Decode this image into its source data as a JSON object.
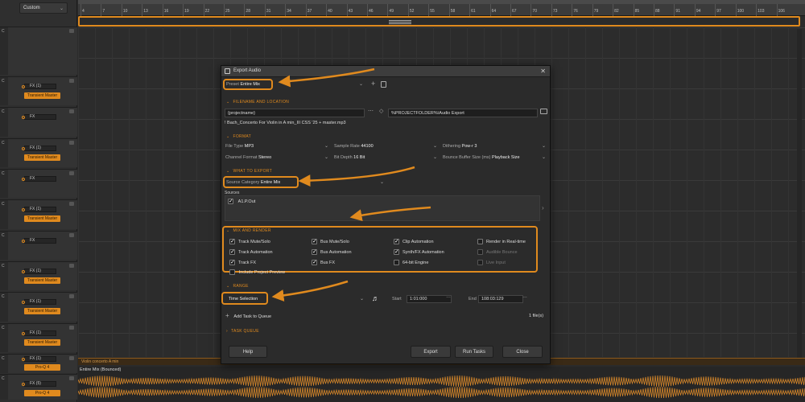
{
  "left_panel": {
    "preset": "Custom",
    "tracks": [
      {
        "fx": "",
        "plugin": ""
      },
      {
        "fx": "FX (1)",
        "plugin": "Transient Master"
      },
      {
        "fx": "FX",
        "plugin": ""
      },
      {
        "fx": "FX (1)",
        "plugin": "Transient Master"
      },
      {
        "fx": "FX",
        "plugin": ""
      },
      {
        "fx": "FX (1)",
        "plugin": "Transient Master"
      },
      {
        "fx": "FX",
        "plugin": ""
      },
      {
        "fx": "FX (1)",
        "plugin": "Transient Master"
      },
      {
        "fx": "FX (1)",
        "plugin": "Transient Master"
      },
      {
        "fx": "FX (1)",
        "plugin": "Transient Master"
      },
      {
        "fx": "FX (1)",
        "plugin": "Pro-Q 4"
      },
      {
        "fx": "FX (5)",
        "plugin": "Pro-Q 4"
      }
    ]
  },
  "ruler": {
    "bars": [
      "4",
      "7",
      "10",
      "13",
      "16",
      "19",
      "22",
      "25",
      "28",
      "31",
      "34",
      "37",
      "40",
      "43",
      "46",
      "49",
      "52",
      "55",
      "58",
      "61",
      "64",
      "67",
      "70",
      "73",
      "76",
      "79",
      "82",
      "85",
      "88",
      "91",
      "94",
      "97",
      "100",
      "103",
      "106"
    ]
  },
  "arrange": {
    "clip_label": "Violin concerto A min",
    "bounce_label": "Entire Mix (Bounced)"
  },
  "dialog": {
    "title": "Export Audio",
    "preset_label": "Preset",
    "preset_value": "Entire Mix",
    "filename_section": "FILENAME AND LOCATION",
    "filename_value": "{projectname}",
    "folder_value": "%PROJECTFOLDER%\\Audio Export",
    "filename_preview": "! Bach_Concerto For Violin in A min_III CSS '25 + master.mp3",
    "format_section": "FORMAT",
    "file_type_label": "File Type",
    "file_type_value": "MP3",
    "sample_rate_label": "Sample Rate",
    "sample_rate_value": "44100",
    "dithering_label": "Dithering",
    "dithering_value": "Pow-r 3",
    "channel_label": "Channel Format",
    "channel_value": "Stereo",
    "bitdepth_label": "Bit Depth",
    "bitdepth_value": "16 Bit",
    "bounce_label": "Bounce Buffer Size (ms)",
    "bounce_value": "Playback Size",
    "what_section": "WHAT TO EXPORT",
    "source_label": "Source Category",
    "source_value": "Entire Mix",
    "sources_label": "Sources",
    "source_item": "A1.P.Out",
    "mix_section": "MIX AND RENDER",
    "mix_checks": [
      {
        "label": "Track Mute/Solo",
        "on": true
      },
      {
        "label": "Bus Mute/Solo",
        "on": true
      },
      {
        "label": "Clip Automation",
        "on": true
      },
      {
        "label": "Render in Real-time",
        "on": false
      },
      {
        "label": "Track Automation",
        "on": true
      },
      {
        "label": "Bus Automation",
        "on": true
      },
      {
        "label": "Synth/FX Automation",
        "on": true
      },
      {
        "label": "Audible Bounce",
        "on": false,
        "disabled": true
      },
      {
        "label": "Track FX",
        "on": true
      },
      {
        "label": "Bus FX",
        "on": true
      },
      {
        "label": "64-bit Engine",
        "on": false
      },
      {
        "label": "Live Input",
        "on": false,
        "disabled": true
      }
    ],
    "include_preview": "Include Project Preview",
    "range_section": "RANGE",
    "range_value": "Time Selection",
    "start_label": "Start",
    "start_value": "1:01:000",
    "end_label": "End",
    "end_value": "108:03:129",
    "add_task": "Add Task to Queue",
    "file_count": "1 file(s)",
    "task_section": "TASK QUEUE",
    "help_btn": "Help",
    "export_btn": "Export",
    "run_btn": "Run Tasks",
    "close_btn": "Close"
  },
  "colors": {
    "accent": "#e08a1e",
    "bg": "#2b2b2b"
  }
}
